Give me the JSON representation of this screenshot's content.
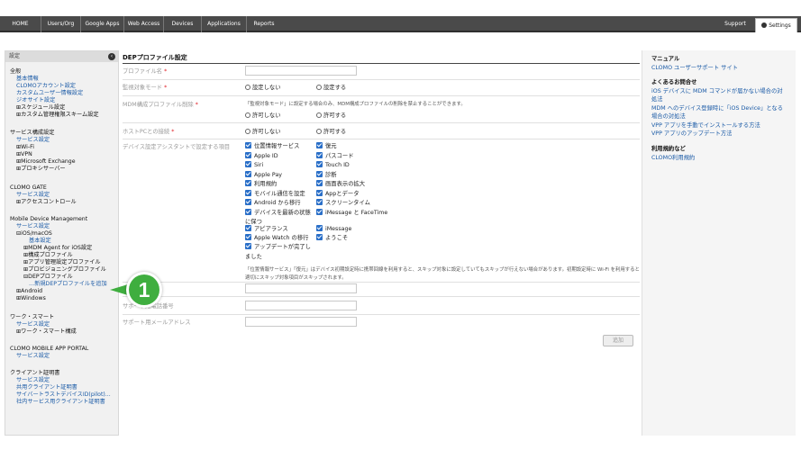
{
  "nav": {
    "tabs": [
      "HOME",
      "Users/Org",
      "Google Apps",
      "Web Access",
      "Devices",
      "Applications",
      "Reports"
    ],
    "support": "Support",
    "settings": "Settings"
  },
  "sidebar": {
    "header": "設定",
    "collapse_icon": "chevron-left-icon",
    "lines": [
      {
        "text": "全般",
        "cls": "sec"
      },
      {
        "text": "基本情報",
        "cls": "lnk"
      },
      {
        "text": "CLOMOアカウント設定",
        "cls": "lnk"
      },
      {
        "text": "カスタムユーザー情報設定",
        "cls": "lnk"
      },
      {
        "text": "ジオサイト設定",
        "cls": "lnk"
      },
      {
        "text": "⊞スケジュール設定",
        "cls": "dark"
      },
      {
        "text": "⊞カスタム管理権限スキーム設定",
        "cls": "dark"
      },
      {
        "text": "サービス構成設定",
        "cls": "sec"
      },
      {
        "text": "サービス設定",
        "cls": "lnk"
      },
      {
        "text": "⊞Wi-Fi",
        "cls": "dark"
      },
      {
        "text": "⊞VPN",
        "cls": "dark"
      },
      {
        "text": "⊞Microsoft Exchange",
        "cls": "dark"
      },
      {
        "text": "⊞プロキシサーバー",
        "cls": "dark"
      },
      {
        "text": "CLOMO GATE",
        "cls": "sec"
      },
      {
        "text": "サービス設定",
        "cls": "lnk"
      },
      {
        "text": "⊞アクセスコントロール",
        "cls": "dark"
      },
      {
        "text": "Mobile Device Management",
        "cls": "sec"
      },
      {
        "text": "サービス設定",
        "cls": "lnk"
      },
      {
        "text": "⊟iOS/macOS",
        "cls": "dark"
      },
      {
        "text": "基本設定",
        "cls": "lnk"
      },
      {
        "text": "⊞MDM Agent for iOS設定",
        "cls": "dark"
      },
      {
        "text": "⊞構成プロファイル",
        "cls": "dark"
      },
      {
        "text": "⊞アプリ管理設定プロファイル",
        "cls": "dark"
      },
      {
        "text": "⊞プロビジョニングプロファイル",
        "cls": "dark"
      },
      {
        "text": "⊟DEPプロファイル",
        "cls": "dark"
      },
      {
        "text": "…新規DEPプロファイルを追加",
        "cls": "lnk"
      },
      {
        "text": "⊞Android",
        "cls": "dark"
      },
      {
        "text": "⊞Windows",
        "cls": "dark"
      },
      {
        "text": "ワーク・スマート",
        "cls": "sec"
      },
      {
        "text": "サービス設定",
        "cls": "lnk"
      },
      {
        "text": "⊞ワーク・スマート構成",
        "cls": "dark"
      },
      {
        "text": "CLOMO MOBILE APP PORTAL",
        "cls": "sec"
      },
      {
        "text": "サービス設定",
        "cls": "lnk"
      },
      {
        "text": "クライアント証明書",
        "cls": "sec"
      },
      {
        "text": "サービス設定",
        "cls": "lnk"
      },
      {
        "text": "共用クライアント証明書",
        "cls": "lnk"
      },
      {
        "text": "サイバートラストデバイスID(pilot)...",
        "cls": "lnk"
      },
      {
        "text": "社内サービス用クライアント証明書",
        "cls": "lnk"
      }
    ]
  },
  "main": {
    "title": "DEPプロファイル設定",
    "profile_name_label": "プロファイル名",
    "supervised_label": "監視対象モード",
    "supervised_options": [
      "設定しない",
      "設定する"
    ],
    "removal_label": "MDM構成プロファイル削除",
    "removal_note": "「監視対象モード」に設定する場合のみ、MDM構成プロファイルの削除を禁止することができます。",
    "removal_options": [
      "許可しない",
      "許可する"
    ],
    "host_pc_label": "ホストPCとの接続",
    "host_pc_options": [
      "許可しない",
      "許可する"
    ],
    "assistant_label": "デバイス設定アシスタントで設定する項目",
    "assistant_left": [
      "位置情報サービス",
      "Apple ID",
      "Siri",
      "Apple Pay",
      "利用規約",
      "モバイル通信を設定",
      "Android から移行",
      "デバイスを最新の状態"
    ],
    "assistant_left_cont1": "に保つ",
    "assistant_left2": [
      "アピアランス",
      "Apple Watch の移行",
      "アップデートが完了し"
    ],
    "assistant_left_cont2": "ました",
    "assistant_right": [
      "復元",
      "パスコード",
      "Touch ID",
      "診断",
      "画面表示の拡大",
      "Appとデータ",
      "スクリーンタイム",
      "iMessage と FaceTime"
    ],
    "assistant_right2": [
      "iMessage",
      "ようこそ"
    ],
    "assistant_note_1": "「位置情報サービス」「復元」はデバイス初期設定時に携帯回線を利用すると、スキップ対象に設定していてもスキップが行えない場合があります。初期設定時に Wi-Fi を利用すると",
    "assistant_note_2": "適切にスキップ対象項目がスキップされます。",
    "support_phone_label": "サポート用電話番号",
    "support_email_label": "サポート用メールアドレス",
    "add_button": "追加"
  },
  "callout": {
    "number": "1",
    "color": "#3fae3f"
  },
  "right_panel": {
    "lines": [
      {
        "text": "マニュアル",
        "cls": "rhead"
      },
      {
        "text": "CLOMO ユーザーサポート サイト",
        "cls": "rlink"
      },
      {
        "text": "よくあるお問合せ",
        "cls": "rhead"
      },
      {
        "text": "iOS デバイスに MDM コマンドが届かない場合の対",
        "cls": "rlink"
      },
      {
        "text": "処法",
        "cls": "rlink"
      },
      {
        "text": "MDM へのデバイス登録時に「iOS Device」となる",
        "cls": "rlink"
      },
      {
        "text": "場合の対処法",
        "cls": "rlink"
      },
      {
        "text": "VPP アプリを手動でインストールする方法",
        "cls": "rlink"
      },
      {
        "text": "VPP アプリのアップデート方法",
        "cls": "rlink"
      },
      {
        "text": "利用規約など",
        "cls": "rhead"
      },
      {
        "text": "CLOMO利用規約",
        "cls": "rlink"
      }
    ]
  },
  "colors": {
    "nav_bg": "#4a4a4a",
    "link": "#1a5aa6",
    "checkbox": "#2a6fc8",
    "required": "#e0242b"
  }
}
